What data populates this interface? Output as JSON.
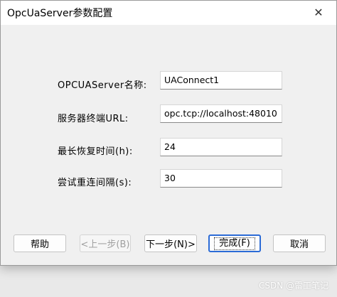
{
  "window": {
    "title": "OpcUaServer参数配置",
    "close_glyph": "✕"
  },
  "form": {
    "fields": [
      {
        "label": "OPCUAServer名称:",
        "value": "UAConnect1"
      },
      {
        "label": "服务器终端URL:",
        "value": "opc.tcp://localhost:48010"
      },
      {
        "label": "最长恢复时间(h):",
        "value": "24"
      },
      {
        "label": "尝试重连间隔(s):",
        "value": "30"
      }
    ]
  },
  "buttons": {
    "help": "帮助",
    "back": "<上一步(B)",
    "next": "下一步(N)>",
    "finish": "完成(F)",
    "cancel": "取消"
  },
  "watermark": "CSDN @雷工笔记"
}
